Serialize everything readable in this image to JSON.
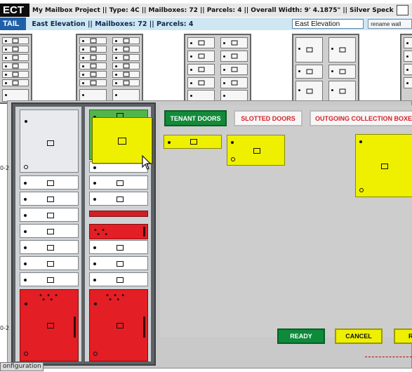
{
  "header": {
    "tag": "ECT",
    "project_info": "My Mailbox Project || Type: 4C || Mailboxes: 72 || Parcels: 4 || Overall Width: 9' 4.1875\" || Silver Speck"
  },
  "subheader": {
    "tag": "TAIL",
    "elevation_info": "East Elevation || Mailboxes: 72 || Parcels: 4",
    "elevation_name_value": "East Elevation",
    "rename_button": "rename wall"
  },
  "palette": {
    "tabs": [
      {
        "label": "TENANT DOORS",
        "active": true
      },
      {
        "label": "SLOTTED DOORS",
        "active": false
      },
      {
        "label": "OUTGOING COLLECTION BOXES",
        "active": false
      }
    ]
  },
  "actions": {
    "ready": "READY",
    "cancel": "CANCEL",
    "next": "R"
  },
  "footer": {
    "label": "onfiguration"
  },
  "edge_labels": [
    "0-2",
    "0-2"
  ],
  "colors": {
    "tenant_door_yellow": "#eef000",
    "parcel_red": "#e31e24",
    "active_tab_green": "#138a3a",
    "selected_green": "#52b44a",
    "info_blue": "#1f5fa8"
  },
  "icons": [
    "mouse-cursor-icon",
    "keyhole-icon",
    "lock-icon"
  ]
}
